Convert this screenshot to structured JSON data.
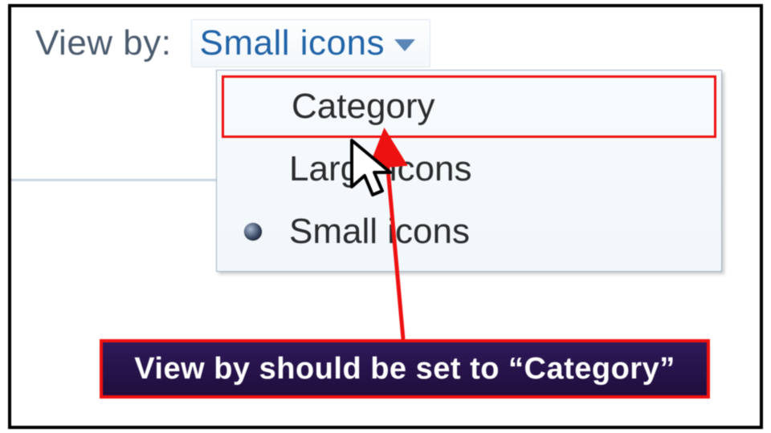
{
  "viewby": {
    "label": "View by:",
    "selected": "Small icons"
  },
  "menu": {
    "items": [
      {
        "label": "Category",
        "highlighted": true,
        "bullet": false
      },
      {
        "label": "Large icons",
        "highlighted": false,
        "bullet": false
      },
      {
        "label": "Small icons",
        "highlighted": false,
        "bullet": true
      }
    ]
  },
  "callout": {
    "text": "View by should be set to “Category”"
  },
  "colors": {
    "highlight_border": "#ee1111",
    "callout_bg": "#2c1453",
    "link_blue": "#2264a8"
  }
}
